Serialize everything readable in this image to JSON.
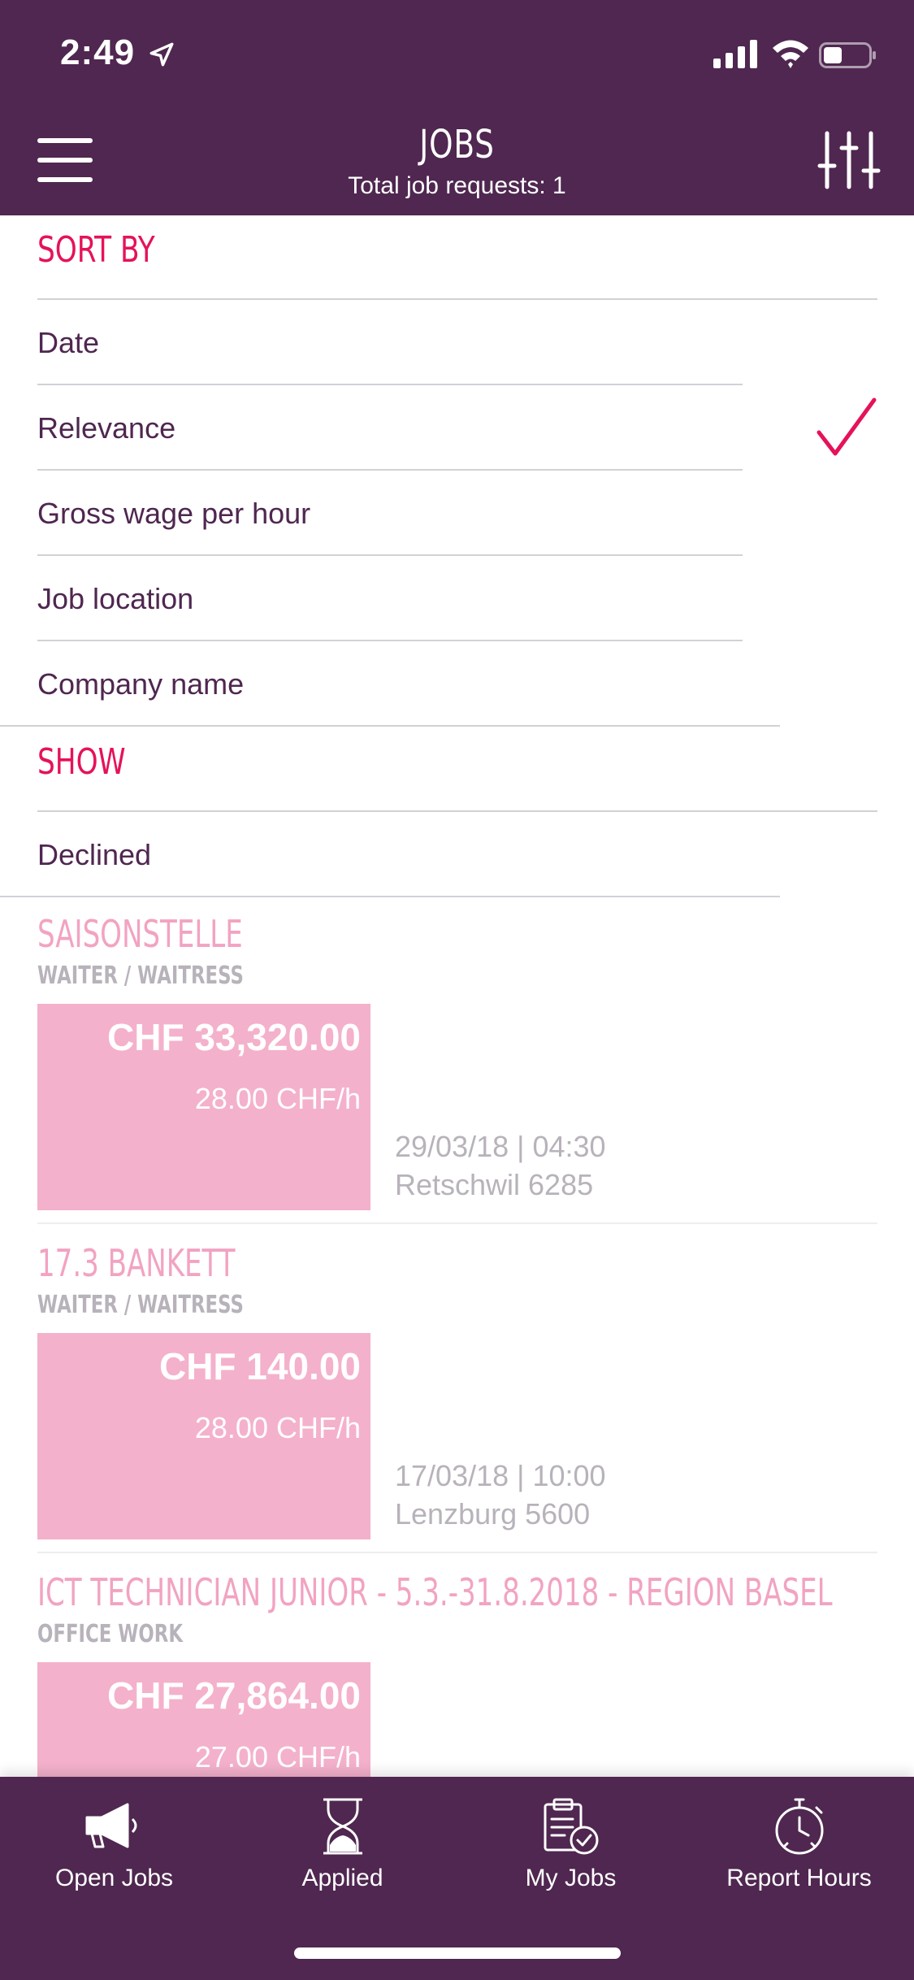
{
  "status_bar": {
    "time": "2:49"
  },
  "header": {
    "title": "JOBS",
    "subtitle": "Total job requests: 1"
  },
  "sort": {
    "title": "SORT BY",
    "options": [
      {
        "label": "Date",
        "selected": false
      },
      {
        "label": "Relevance",
        "selected": true
      },
      {
        "label": "Gross wage per hour",
        "selected": false
      },
      {
        "label": "Job location",
        "selected": false
      },
      {
        "label": "Company name",
        "selected": false
      }
    ]
  },
  "show": {
    "title": "SHOW",
    "options": [
      {
        "label": "Declined"
      }
    ]
  },
  "jobs": [
    {
      "title": "SAISONSTELLE",
      "category": "WAITER / WAITRESS",
      "total": "CHF 33,320.00",
      "rate": "28.00 CHF/h",
      "date": "29/03/18 | 04:30",
      "location": "Retschwil 6285"
    },
    {
      "title": "17.3 BANKETT",
      "category": "WAITER / WAITRESS",
      "total": "CHF 140.00",
      "rate": "28.00 CHF/h",
      "date": "17/03/18 | 10:00",
      "location": "Lenzburg 5600"
    },
    {
      "title": "ICT TECHNICIAN JUNIOR - 5.3.-31.8.2018 - REGION BASEL",
      "category": "OFFICE WORK",
      "total": "CHF 27,864.00",
      "rate": "27.00 CHF/h"
    }
  ],
  "tabs": [
    {
      "label": "Open Jobs",
      "icon": "megaphone-icon"
    },
    {
      "label": "Applied",
      "icon": "hourglass-icon"
    },
    {
      "label": "My Jobs",
      "icon": "clipboard-check-icon"
    },
    {
      "label": "Report Hours",
      "icon": "stopwatch-icon"
    }
  ],
  "colors": {
    "brand": "#4f2750",
    "accent": "#e5125a",
    "job_pink": "#f4b1cb",
    "muted": "#b8b2ba"
  }
}
